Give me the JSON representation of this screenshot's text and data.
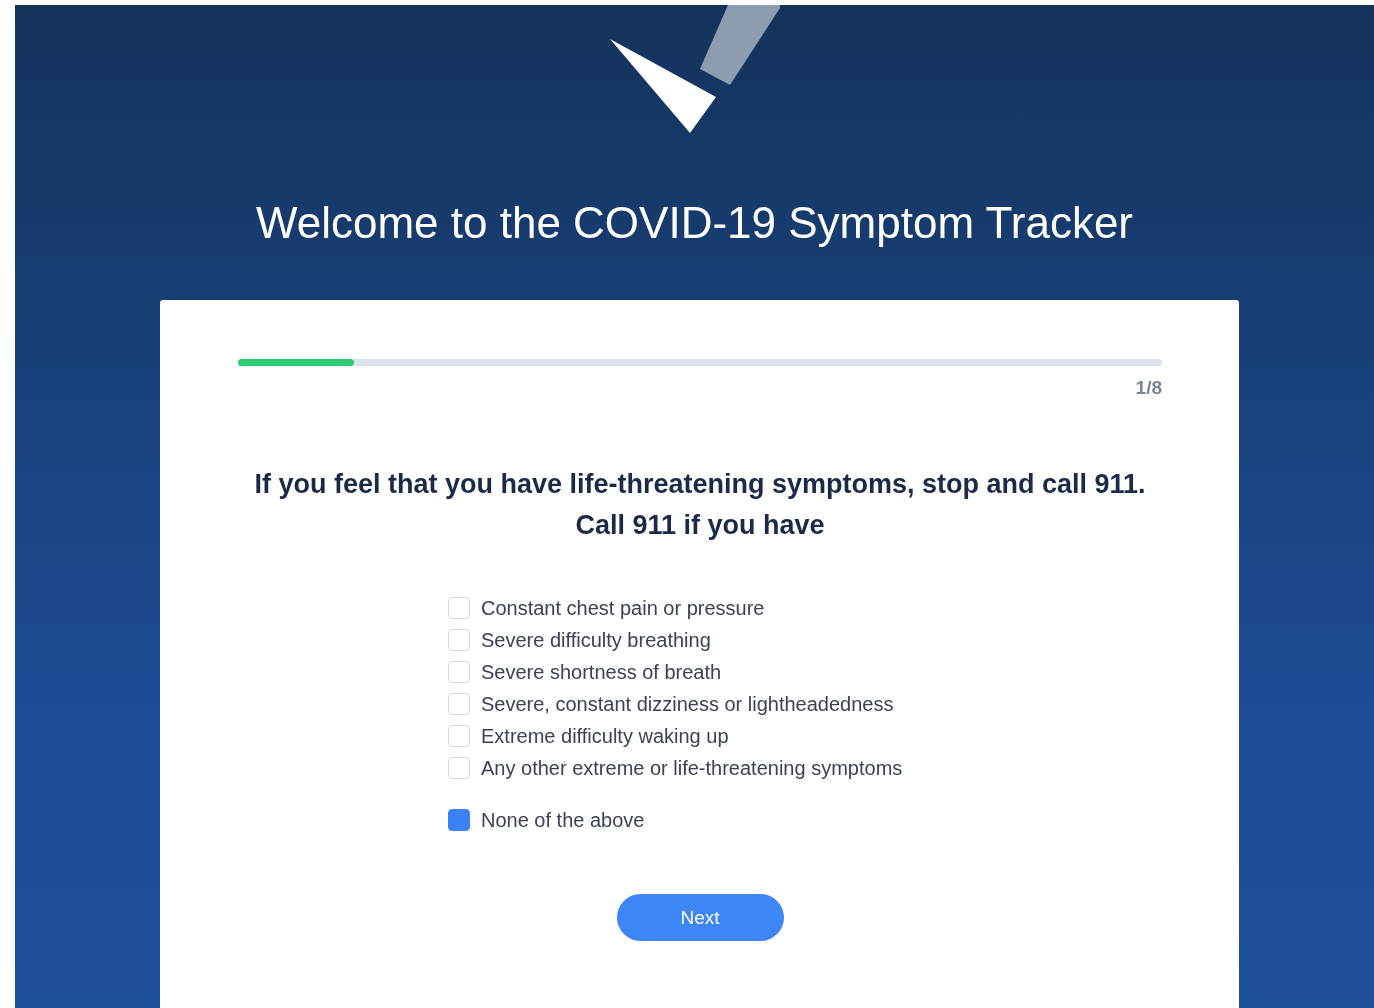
{
  "header": {
    "title": "Welcome to the COVID-19 Symptom Tracker"
  },
  "progress": {
    "level": 0.125,
    "step": "1/8"
  },
  "question": "If you feel that you have life-threatening symptoms, stop and call 911. Call 911 if you have",
  "options": [
    {
      "label": "Constant chest pain or pressure",
      "checked": false,
      "kind": "symptom"
    },
    {
      "label": "Severe difficulty breathing",
      "checked": false,
      "kind": "symptom"
    },
    {
      "label": "Severe shortness of breath",
      "checked": false,
      "kind": "symptom"
    },
    {
      "label": "Severe, constant dizziness or lightheadedness",
      "checked": false,
      "kind": "symptom"
    },
    {
      "label": "Extreme difficulty waking up",
      "checked": false,
      "kind": "symptom"
    },
    {
      "label": "Any other extreme or life-threatening symptoms",
      "checked": false,
      "kind": "symptom"
    },
    {
      "label": "None of the above",
      "checked": true,
      "kind": "none"
    }
  ],
  "next_button": "Next"
}
